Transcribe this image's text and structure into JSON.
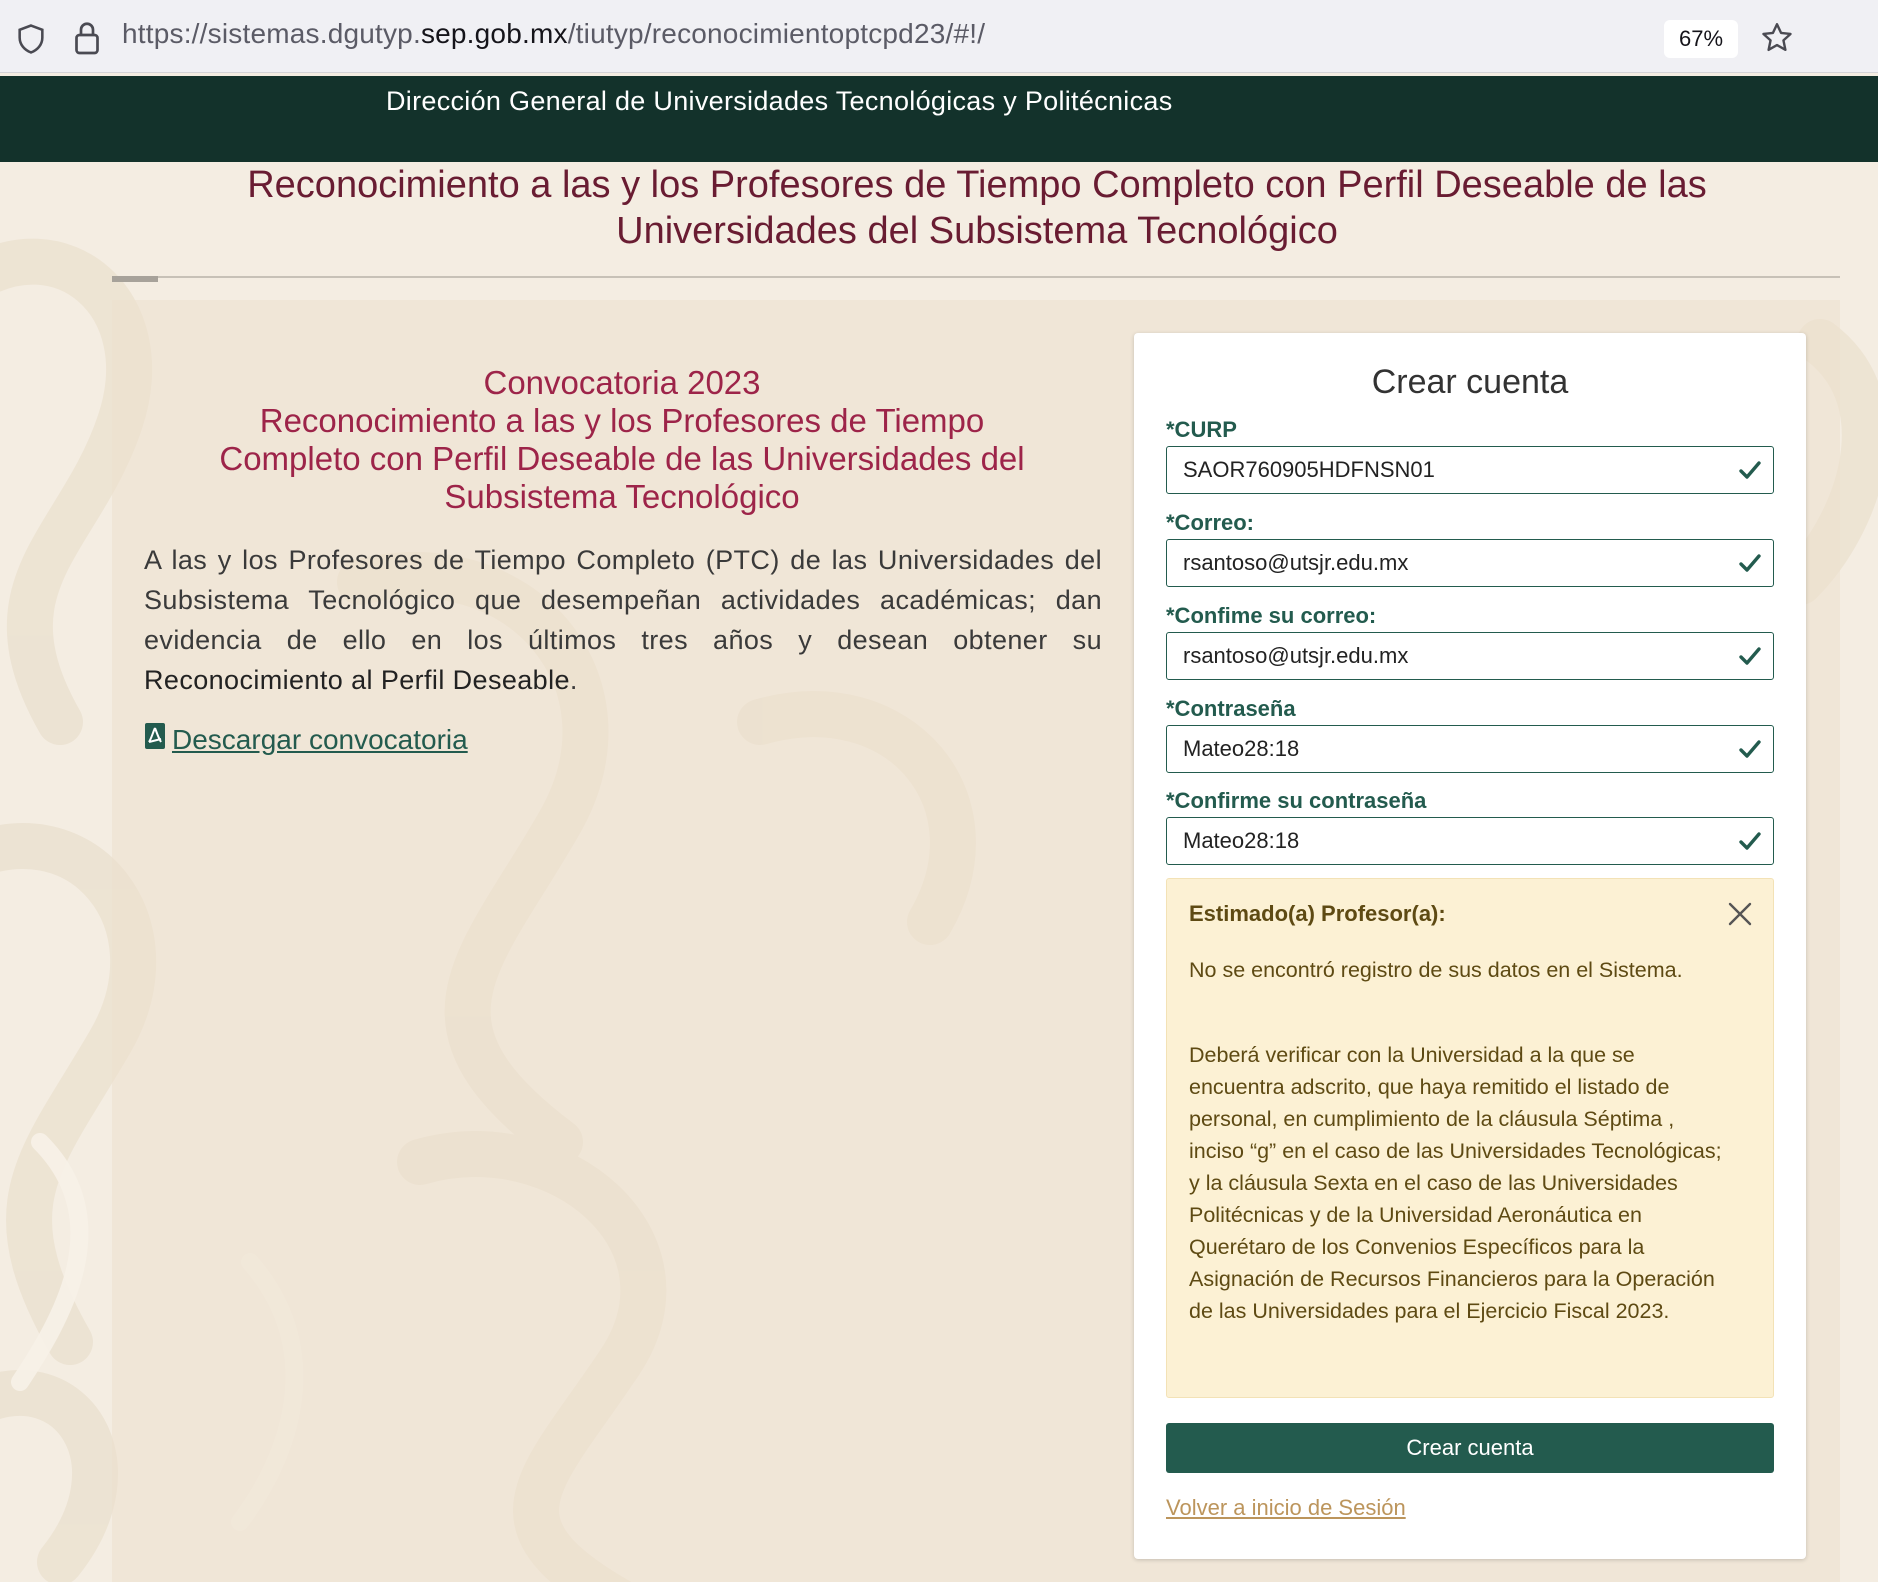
{
  "browser": {
    "url_prefix": "https://sistemas.dgutyp.",
    "url_domain": "sep.gob.mx",
    "url_path": "/tiutyp/reconocimientoptcpd23/#!/",
    "zoom": "67%"
  },
  "header": {
    "title": "Dirección General de Universidades Tecnológicas y Politécnicas"
  },
  "page": {
    "title_line1": "Reconocimiento a las y los Profesores de Tiempo Completo con Perfil Deseable de las",
    "title_line2": "Universidades del Subsistema Tecnológico"
  },
  "intro": {
    "line1": "Convocatoria 2023",
    "line2": "Reconocimiento a las y los Profesores de Tiempo",
    "line3": "Completo con Perfil Deseable de las Universidades del",
    "line4": "Subsistema Tecnológico",
    "body": "A las y los Profesores de Tiempo Completo (PTC) de las Universidades del Subsistema Tecnológico que desempeñan actividades académicas; dan evidencia de ello en los últimos tres años y desean obtener su",
    "body_bold": "Reconocimiento al Perfil Deseable",
    "body_end": ".",
    "download_label": "Descargar convocatoria"
  },
  "form": {
    "title": "Crear cuenta",
    "fields": [
      {
        "label": "*CURP",
        "value": "SAOR760905HDFNSN01"
      },
      {
        "label": "*Correo:",
        "value": "rsantoso@utsjr.edu.mx"
      },
      {
        "label": "*Confime su correo:",
        "value": "rsantoso@utsjr.edu.mx"
      },
      {
        "label": "*Contraseña",
        "value": "Mateo28:18"
      },
      {
        "label": "*Confirme su contraseña",
        "value": "Mateo28:18"
      }
    ],
    "alert": {
      "title": "Estimado(a) Profesor(a):",
      "p1": "No se encontró registro de sus datos en el Sistema.",
      "p2": "Deberá verificar con la Universidad a la que se encuentra adscrito, que haya remitido el listado de personal, en cumplimiento de la cláusula Séptima , inciso “g” en el caso de las Universidades Tecnológicas; y la cláusula Sexta en el caso de las Universidades Politécnicas y de la Universidad Aeronáutica en Querétaro de los Convenios Específicos para la Asignación de Recursos Financieros para la Operación de las Universidades para el Ejercicio Fiscal 2023."
    },
    "submit_label": "Crear cuenta",
    "back_link": "Volver a inicio de Sesión"
  },
  "colors": {
    "header_bg": "#13322b",
    "primary_green": "#235b4e",
    "title_maroon": "#691c32",
    "intro_red": "#9d2449",
    "gold_link": "#bc955c",
    "alert_bg": "#fcf1d4"
  },
  "icons": [
    "shield-icon",
    "lock-icon",
    "star-icon",
    "pdf-icon",
    "check-icon",
    "close-icon"
  ]
}
